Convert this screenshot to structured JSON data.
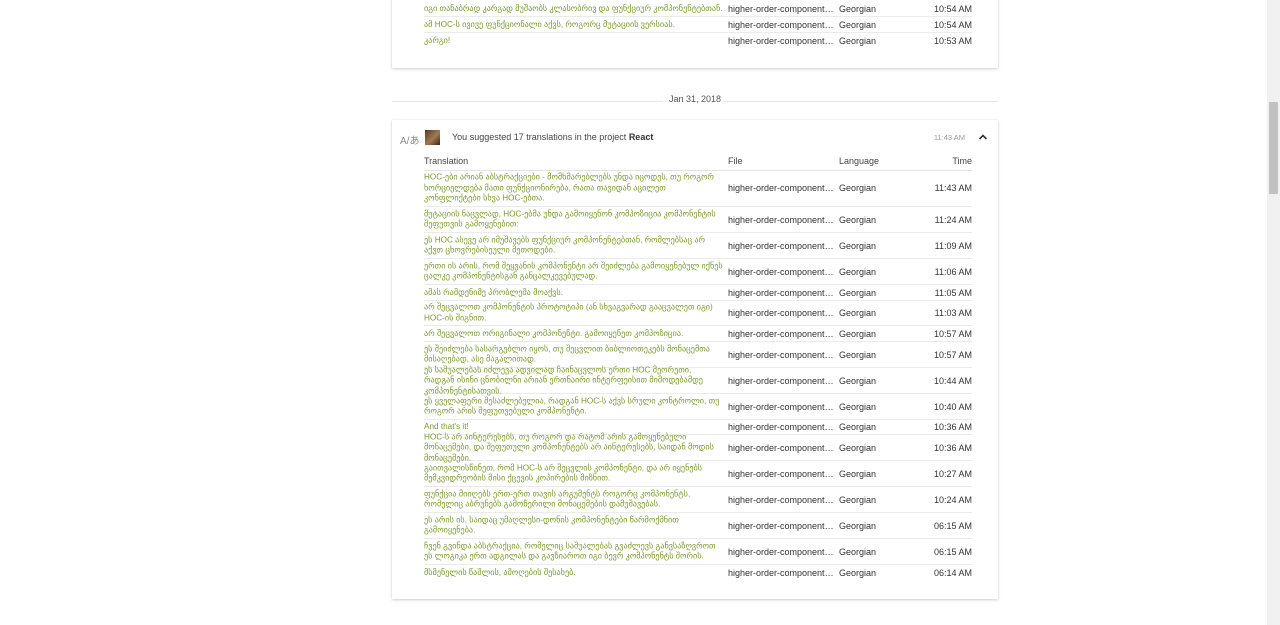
{
  "top_card": {
    "rows": [
      {
        "translation": "იგი თანაბრად კარგად მუშაობს კლასობრივ და ფუნქციურ კომპონენტებთან.",
        "file": "higher-order-components...",
        "language": "Georgian",
        "time": "10:54 AM"
      },
      {
        "translation": "ამ HOC-ს ივივე ფუნქციონალი აქვს, როგორც მუტაციის ვერსიას.",
        "file": "higher-order-components...",
        "language": "Georgian",
        "time": "10:54 AM"
      },
      {
        "translation": "კარგი!",
        "file": "higher-order-components...",
        "language": "Georgian",
        "time": "10:53 AM"
      }
    ]
  },
  "date_separator": "Jan 31, 2018",
  "activity": {
    "summary_prefix": "You suggested 17 translations in the project",
    "project": "React",
    "time": "11:43 AM",
    "columns": {
      "translation": "Translation",
      "file": "File",
      "language": "Language",
      "time": "Time"
    },
    "rows": [
      {
        "translation": "HOC-ები არიან აბსტრაქციები - მომხმარებლებს უნდა იცოდეს, თუ როგორ ხორციელდება მათი ფუნქციონირება, რათა თავიდან აცილეთ კონფლიქტები სხვა HOC-ებთა.",
        "file": "higher-order-components...",
        "language": "Georgian",
        "time": "11:43 AM"
      },
      {
        "translation": "მუტაციის ნაცვლად, HOC-ებმა უნდა გამოიყენონ კომპოზიცია კომპონენტის შეფუთვის გამოყენებით:",
        "file": "higher-order-components...",
        "language": "Georgian",
        "time": "11:24 AM"
      },
      {
        "translation": "ეს HOC ასევე არ იმუშავებს ფუნქციურ კომპონენტებთან, რომლებსაც არ აქვთ ცხოვრებისეული მეთოდები.",
        "file": "higher-order-components...",
        "language": "Georgian",
        "time": "11:09 AM"
      },
      {
        "translation": "ერთი ის არის, რომ შეყვანის კომპონენტი არ შეიძლება გამოიყენებულ იქნეს ცალკე კომპონენტისგან განცალკევებულად.",
        "file": "higher-order-components...",
        "language": "Georgian",
        "time": "11:06 AM"
      },
      {
        "translation": "ამას რამდენიმე პრობლემა მოაქვს.",
        "file": "higher-order-components...",
        "language": "Georgian",
        "time": "11:05 AM"
      },
      {
        "translation": "არ შეცვალოთ კომპონენტის პროტოტიპი (ან სხვაგვარად გააცვალეთ იგი) HOC-ის შიგნით.",
        "file": "higher-order-components...",
        "language": "Georgian",
        "time": "11:03 AM"
      },
      {
        "translation": "არ შეცვალოთ ორიგინალი კომპონენტი. გამოიყენეთ კომპოზიცია.",
        "file": "higher-order-components...",
        "language": "Georgian",
        "time": "10:57 AM"
      },
      {
        "translation": "ეს შეიძლება სასარგებლო იყოს, თუ შეცვლით ბიბლიოთეკებს მონაცემთა მისაღებად, ასე მაგალითად.",
        "file": "higher-order-components...",
        "language": "Georgian",
        "time": "10:57 AM"
      },
      {
        "translation": "ეს საშუალებას იძლევა ადვილად ჩაინაცვლოს ერთი HOC მეორეთი, რადგან ისინი ცნობილნი არიან ერთნაირი ინტერფეისით მიმოდებამდე კომპონენტისათვის.",
        "file": "higher-order-components...",
        "language": "Georgian",
        "time": "10:44 AM"
      },
      {
        "translation": "ეს ყველაფერი შესაძლებელია, რადგან HOC-ს აქვს სრული კონტროლი, თუ როგორ არის შეფუთვებული კომპონენტი.",
        "file": "higher-order-components...",
        "language": "Georgian",
        "time": "10:40 AM"
      },
      {
        "translation": "And that's it!",
        "file": "higher-order-components...",
        "language": "Georgian",
        "time": "10:36 AM"
      },
      {
        "translation": "HOC-ს არ აინტერესებს, თუ როგორ და რატომ არის გამოყენებული მონაცემები, და შეფუთული კომპონენტებს არ აინტერესებს, საიდან მოდის მონაცემები.",
        "file": "higher-order-components...",
        "language": "Georgian",
        "time": "10:36 AM"
      },
      {
        "translation": "გაითვალისწინეთ, რომ HOC-ს არ შეცვლის კომპონენტი, და არ იყენებს მემკვიდრეობის მისი ქცევის კოპირების მიზნით.",
        "file": "higher-order-components...",
        "language": "Georgian",
        "time": "10:27 AM"
      },
      {
        "translation": "ფუნქცია მიიღებს ერთ-ერთ თავის არგუმენტს როგორც კომპონენტს, რომელიც აბრუნებს გამოწერილი მონაცემების დამუშავებას.",
        "file": "higher-order-components...",
        "language": "Georgian",
        "time": "10:24 AM"
      },
      {
        "translation": "ეს არის ის, საიდაც უმაღლესი-დონის კომპონენტები წარმოქმნით გამოიყენება.",
        "file": "higher-order-components...",
        "language": "Georgian",
        "time": "06:15 AM"
      },
      {
        "translation": "ჩვენ გვინდა აბსტრაქცია, რომელიც საშუალებას გვაძლევს განვსაზღვროთ ეს ლოგიკა ერთ ადგილას და გავზიაროთ იგი ბევრ კომპონენტს შორის.",
        "file": "higher-order-components...",
        "language": "Georgian",
        "time": "06:15 AM"
      },
      {
        "translation": "მსმენელის წაშლის, ამოღების შესახებ.",
        "file": "higher-order-components...",
        "language": "Georgian",
        "time": "06:14 AM"
      }
    ]
  }
}
